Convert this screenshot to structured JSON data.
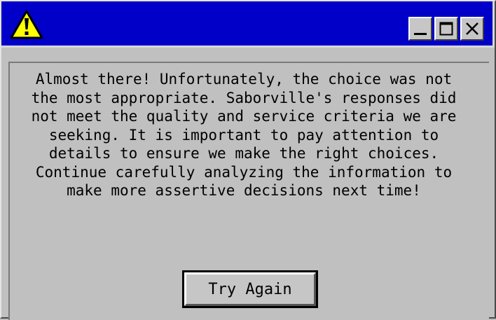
{
  "window": {
    "titlebar_color": "#0000c8",
    "background_color": "#c0c0c0",
    "title_icon": "warning-icon",
    "title_buttons": [
      {
        "name": "minimize",
        "icon": "minimize-icon"
      },
      {
        "name": "maximize",
        "icon": "maximize-icon"
      },
      {
        "name": "close",
        "icon": "close-icon"
      }
    ]
  },
  "dialog": {
    "message": "Almost there! Unfortunately, the choice was not the most appropriate. Saborville's responses did not meet the quality and service criteria we are seeking. It is important to pay attention to details to ensure we make the right choices. Continue carefully analyzing the information to make more assertive decisions next time!",
    "button_label": "Try Again"
  }
}
